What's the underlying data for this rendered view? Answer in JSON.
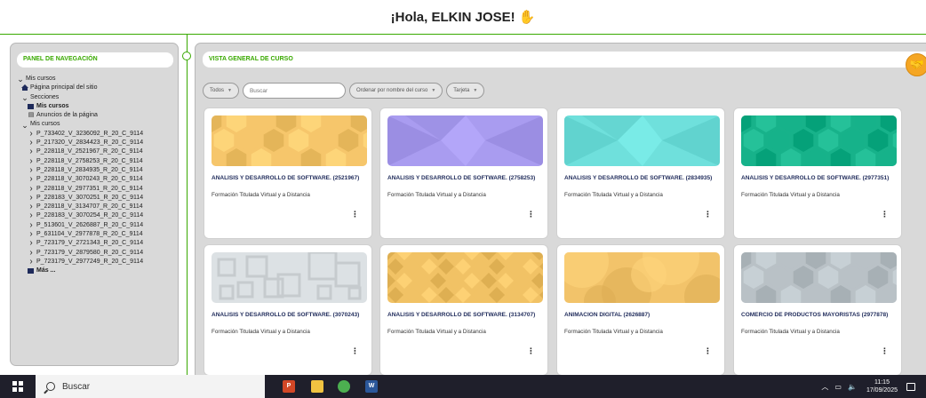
{
  "header": {
    "greeting": "¡Hola, ELKIN JOSE!",
    "wave_icon": "hand-wave-icon"
  },
  "nav_panel": {
    "title": "PANEL DE NAVEGACIÓN",
    "tree": [
      {
        "label": "Mis cursos",
        "level": 0,
        "icon": "chevron-down-icon",
        "bold": false
      },
      {
        "label": "Página principal del sitio",
        "level": 1,
        "icon": "home-icon",
        "bold": false
      },
      {
        "label": "Secciones",
        "level": 1,
        "icon": "chevron-down-icon",
        "bold": false
      },
      {
        "label": "Mis cursos",
        "level": 2,
        "icon": "square-icon",
        "bold": true
      },
      {
        "label": "Anuncios de la página",
        "level": 2,
        "icon": "forum-icon",
        "bold": false
      },
      {
        "label": "Mis cursos",
        "level": 1,
        "icon": "chevron-down-icon",
        "bold": false
      },
      {
        "label": "P_733402_V_3236092_R_20_C_9114",
        "level": 2,
        "icon": "chevron-right-icon",
        "bold": false
      },
      {
        "label": "P_217320_V_2834423_R_20_C_9114",
        "level": 2,
        "icon": "chevron-right-icon",
        "bold": false
      },
      {
        "label": "P_228118_V_2521967_R_20_C_9114",
        "level": 2,
        "icon": "chevron-right-icon",
        "bold": false
      },
      {
        "label": "P_228118_V_2758253_R_20_C_9114",
        "level": 2,
        "icon": "chevron-right-icon",
        "bold": false
      },
      {
        "label": "P_228118_V_2834935_R_20_C_9114",
        "level": 2,
        "icon": "chevron-right-icon",
        "bold": false
      },
      {
        "label": "P_228118_V_3070243_R_20_C_9114",
        "level": 2,
        "icon": "chevron-right-icon",
        "bold": false
      },
      {
        "label": "P_228118_V_2977351_R_20_C_9114",
        "level": 2,
        "icon": "chevron-right-icon",
        "bold": false
      },
      {
        "label": "P_228183_V_3070251_R_20_C_9114",
        "level": 2,
        "icon": "chevron-right-icon",
        "bold": false
      },
      {
        "label": "P_228118_V_3134707_R_20_C_9114",
        "level": 2,
        "icon": "chevron-right-icon",
        "bold": false
      },
      {
        "label": "P_228183_V_3070254_R_20_C_9114",
        "level": 2,
        "icon": "chevron-right-icon",
        "bold": false
      },
      {
        "label": "P_513601_V_2626887_R_20_C_9114",
        "level": 2,
        "icon": "chevron-right-icon",
        "bold": false
      },
      {
        "label": "P_631104_V_2977878_R_20_C_9114",
        "level": 2,
        "icon": "chevron-right-icon",
        "bold": false
      },
      {
        "label": "P_723179_V_2721343_R_20_C_9114",
        "level": 2,
        "icon": "chevron-right-icon",
        "bold": false
      },
      {
        "label": "P_723179_V_2879580_R_20_C_9114",
        "level": 2,
        "icon": "chevron-right-icon",
        "bold": false
      },
      {
        "label": "P_723179_V_2977249_R_20_C_9114",
        "level": 2,
        "icon": "chevron-right-icon",
        "bold": false
      },
      {
        "label": "Más ...",
        "level": 2,
        "icon": "square-icon",
        "bold": true
      }
    ]
  },
  "main_panel": {
    "title": "VISTA GENERAL DE CURSO",
    "filters": {
      "status": "Todos",
      "search_placeholder": "Buscar",
      "sort": "Ordenar por nombre del curso",
      "view": "Tarjeta"
    },
    "courses": [
      {
        "title": "ANALISIS Y DESARROLLO DE SOFTWARE. (2521967)",
        "category": "Formación Titulada Virtual y a Distancia",
        "pattern": "hexagons",
        "color": "#f6c66b"
      },
      {
        "title": "ANALISIS Y DESARROLLO DE SOFTWARE. (2758253)",
        "category": "Formación Titulada Virtual y a Distancia",
        "pattern": "triangles",
        "color": "#a99cf0"
      },
      {
        "title": "ANALISIS Y DESARROLLO DE SOFTWARE. (2834935)",
        "category": "Formación Titulada Virtual y a Distancia",
        "pattern": "triangles",
        "color": "#6fe0dc"
      },
      {
        "title": "ANALISIS Y DESARROLLO DE SOFTWARE. (2977351)",
        "category": "Formación Titulada Virtual y a Distancia",
        "pattern": "hexagons",
        "color": "#17b28a"
      },
      {
        "title": "ANALISIS Y DESARROLLO DE SOFTWARE. (3070243)",
        "category": "Formación Titulada Virtual y a Distancia",
        "pattern": "squares",
        "color": "#dce1e4"
      },
      {
        "title": "ANALISIS Y DESARROLLO DE SOFTWARE. (3134707)",
        "category": "Formación Titulada Virtual y a Distancia",
        "pattern": "diamonds",
        "color": "#f1c265"
      },
      {
        "title": "ANIMACION DIGITAL (2626887)",
        "category": "Formación Titulada Virtual y a Distancia",
        "pattern": "circles",
        "color": "#f2c36a"
      },
      {
        "title": "COMERCIO DE PRODUCTOS MAYORISTAS (2977878)",
        "category": "Formación Titulada Virtual y a Distancia",
        "pattern": "hexagons",
        "color": "#b9c1c6"
      }
    ],
    "menu_glyph": "⋮"
  },
  "taskbar": {
    "search_label": "Buscar",
    "time": "11:15",
    "date": "17/09/2025",
    "apps": [
      {
        "icon": "powerpoint-icon",
        "letter": "P",
        "color": "#d24726"
      },
      {
        "icon": "file-explorer-icon",
        "letter": "",
        "color": "#f0c341"
      },
      {
        "icon": "chrome-icon",
        "letter": "",
        "color": "#4caf50"
      },
      {
        "icon": "word-icon",
        "letter": "W",
        "color": "#2b579a"
      }
    ]
  },
  "colors": {
    "accent": "#39a900",
    "navy": "#1e2a5a",
    "panel_bg": "#d9d9d9",
    "badge": "#f5a623"
  }
}
